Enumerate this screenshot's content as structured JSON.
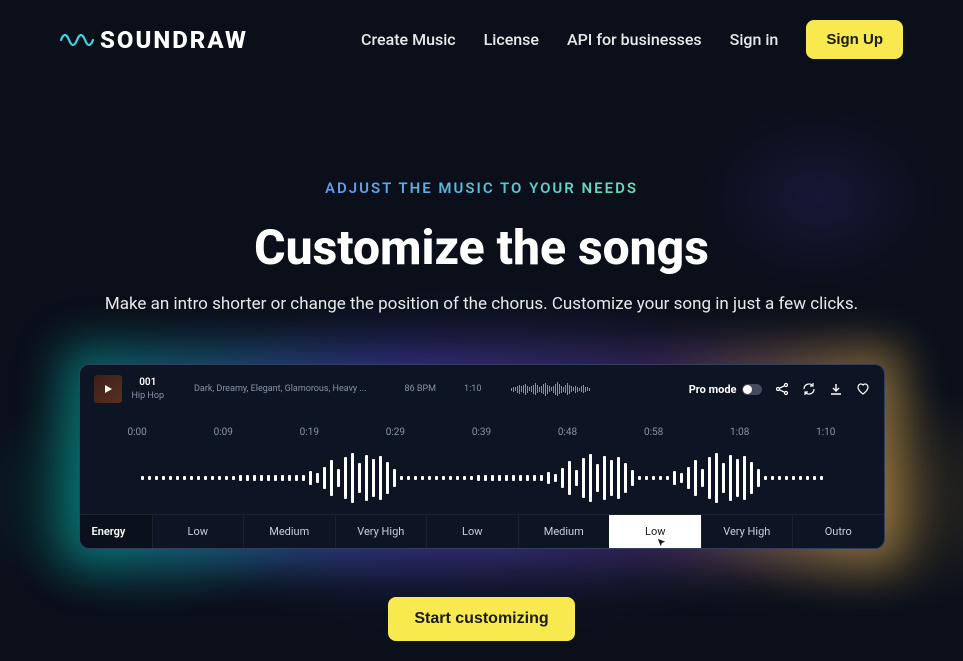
{
  "header": {
    "logo_text": "SOUNDRAW",
    "nav": [
      "Create Music",
      "License",
      "API for businesses",
      "Sign in"
    ],
    "signup": "Sign Up"
  },
  "hero": {
    "eyebrow": "ADJUST THE MUSIC TO YOUR NEEDS",
    "headline": "Customize the songs",
    "subhead": "Make an intro shorter or change the position of the chorus. Customize your song in just a few clicks."
  },
  "editor": {
    "track": {
      "id": "001",
      "genre": "Hip Hop",
      "tags": "Dark, Dreamy, Elegant, Glamorous, Heavy ...",
      "bpm": "86 BPM",
      "duration": "1:10",
      "pro_mode": "Pro mode"
    },
    "timeline": [
      "0:00",
      "0:09",
      "0:19",
      "0:29",
      "0:39",
      "0:48",
      "0:58",
      "1:08",
      "1:10"
    ],
    "energy_label": "Energy",
    "energy_segments": [
      "Low",
      "Medium",
      "Very High",
      "Low",
      "Medium",
      "Low",
      "Very High",
      "Outro"
    ],
    "active_segment_index": 5
  },
  "cta": "Start customizing"
}
